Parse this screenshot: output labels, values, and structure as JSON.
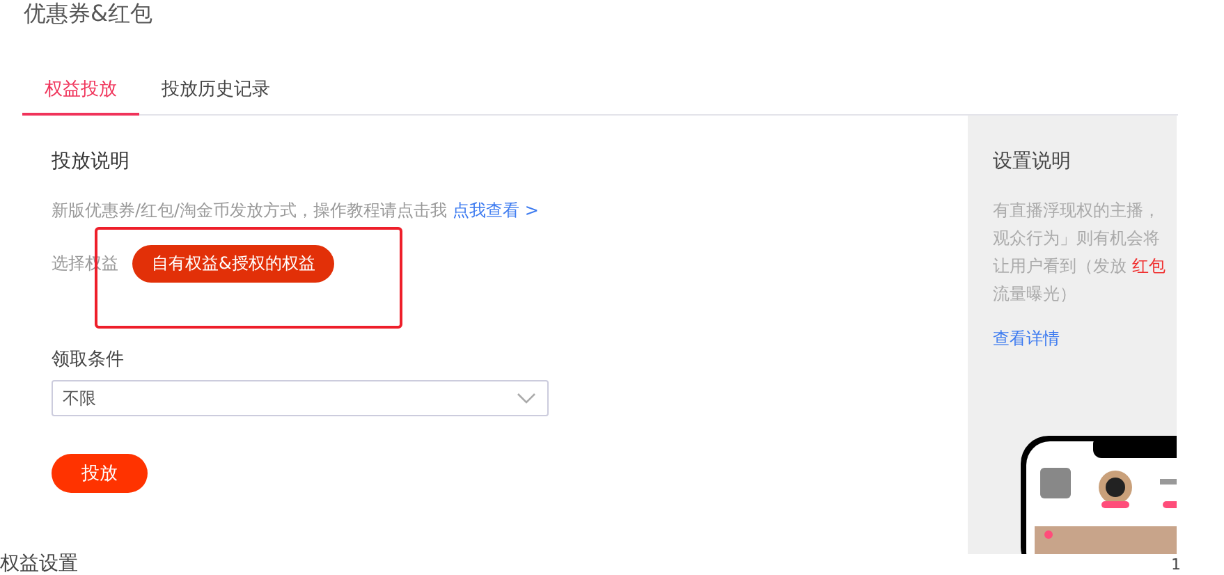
{
  "page_title": "优惠券&红包",
  "tabs": [
    {
      "label": "权益投放",
      "selected": true
    },
    {
      "label": "投放历史记录",
      "selected": false
    }
  ],
  "release_info": {
    "heading": "投放说明",
    "description": "新版优惠券/红包/淘金币发放方式，操作教程请点击我",
    "link": "点我查看 >"
  },
  "benefit_select": {
    "label": "选择权益",
    "option": "自有权益&授权的权益",
    "selected": true,
    "annotated": true
  },
  "condition": {
    "label": "领取条件",
    "value": "不限"
  },
  "submit": "投放",
  "section_title": "权益设置",
  "side_panel": {
    "heading": "设置说明",
    "lines": [
      [
        {
          "text": "有直播浮现权的主播，",
          "highlight": false
        }
      ],
      [
        {
          "text": "观众行为」则有机会将",
          "highlight": false
        }
      ],
      [
        {
          "text": "让用户看到（发放 ",
          "highlight": false
        },
        {
          "text": "红包",
          "highlight": true
        }
      ],
      [
        {
          "text": "流量曝光）",
          "highlight": false
        }
      ]
    ],
    "link": "查看详情",
    "preview": {
      "kind": "picture"
    }
  },
  "corner_mark": "1"
}
